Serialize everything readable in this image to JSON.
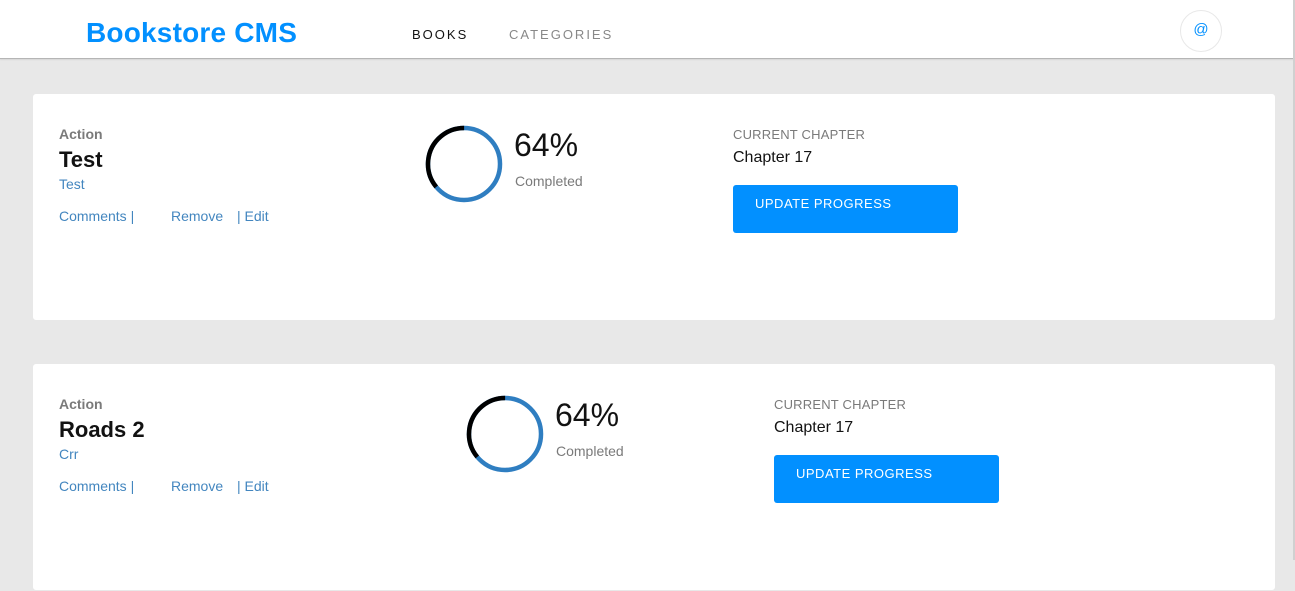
{
  "header": {
    "logo": "Bookstore CMS",
    "nav": [
      {
        "label": "BOOKS",
        "active": true
      },
      {
        "label": "CATEGORIES",
        "active": false
      }
    ],
    "avatar_icon": "@"
  },
  "books": [
    {
      "genre": "Action",
      "title": "Test",
      "author": "Test",
      "actions": {
        "comments": "Comments |",
        "remove": "Remove",
        "edit": "| Edit"
      },
      "progress": {
        "percent_label": "64%",
        "percent_value": 64,
        "completed_label": "Completed"
      },
      "chapter": {
        "label": "CURRENT CHAPTER",
        "value": "Chapter 17"
      },
      "update_button": "UPDATE PROGRESS"
    },
    {
      "genre": "Action",
      "title": "Roads 2",
      "author": "Crr",
      "actions": {
        "comments": "Comments |",
        "remove": "Remove",
        "edit": "| Edit"
      },
      "progress": {
        "percent_label": "64%",
        "percent_value": 64,
        "completed_label": "Completed"
      },
      "chapter": {
        "label": "CURRENT CHAPTER",
        "value": "Chapter 17"
      },
      "update_button": "UPDATE PROGRESS"
    }
  ],
  "colors": {
    "brand": "#0290ff",
    "link": "#4386bf",
    "progress_ring": "#2f7ec1",
    "progress_ring_remainder": "#000000",
    "page_background": "#e8e8e8"
  }
}
